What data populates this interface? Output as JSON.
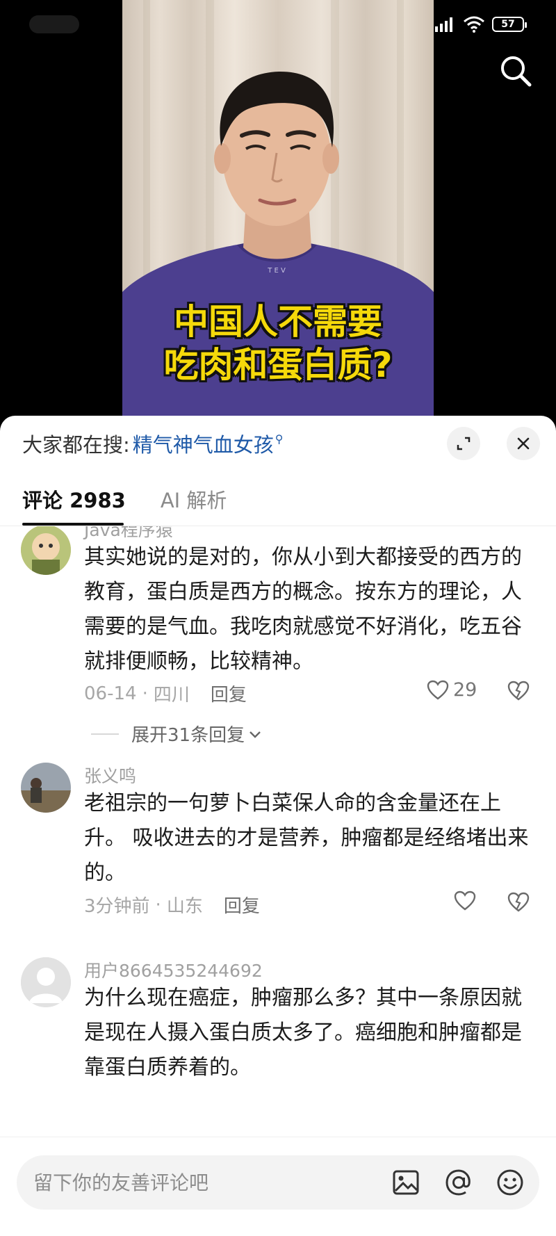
{
  "status_bar": {
    "battery": "57"
  },
  "video": {
    "caption_line1": "中国人不需要",
    "caption_line2": "吃肉和蛋白质?"
  },
  "panel": {
    "hot_search_prefix": "大家都在搜:",
    "hot_search_term": "精气神气血女孩",
    "tabs": [
      {
        "label": "评论 2983",
        "active": true
      },
      {
        "label": "AI 解析",
        "active": false
      }
    ]
  },
  "comments": [
    {
      "username": "Java程序猿",
      "text": "其实她说的是对的，你从小到大都接受的西方的教育，蛋白质是西方的概念。按东方的理论，人需要的是气血。我吃肉就感觉不好消化，吃五谷就排便顺畅，比较精神。",
      "time": "06-14",
      "location": "四川",
      "reply": "回复",
      "likes": "29",
      "expand": "展开31条回复"
    },
    {
      "username": "张义鸣",
      "text": "老祖宗的一句萝卜白菜保人命的含金量还在上升。 吸收进去的才是营养，肿瘤都是经络堵出来的。",
      "time": "3分钟前",
      "location": "山东",
      "reply": "回复"
    },
    {
      "username": "用户8664535244692",
      "text": "为什么现在癌症，肿瘤那么多？其中一条原因就是现在人摄入蛋白质太多了。癌细胞和肿瘤都是靠蛋白质养着的。"
    }
  ],
  "input": {
    "placeholder": "留下你的友善评论吧"
  },
  "icons": [
    "search-icon",
    "collapse-icon",
    "close-icon",
    "heart-icon",
    "dislike-icon",
    "chevron-down-icon",
    "image-icon",
    "at-icon",
    "emoji-icon",
    "wifi-icon",
    "signal-icon"
  ]
}
